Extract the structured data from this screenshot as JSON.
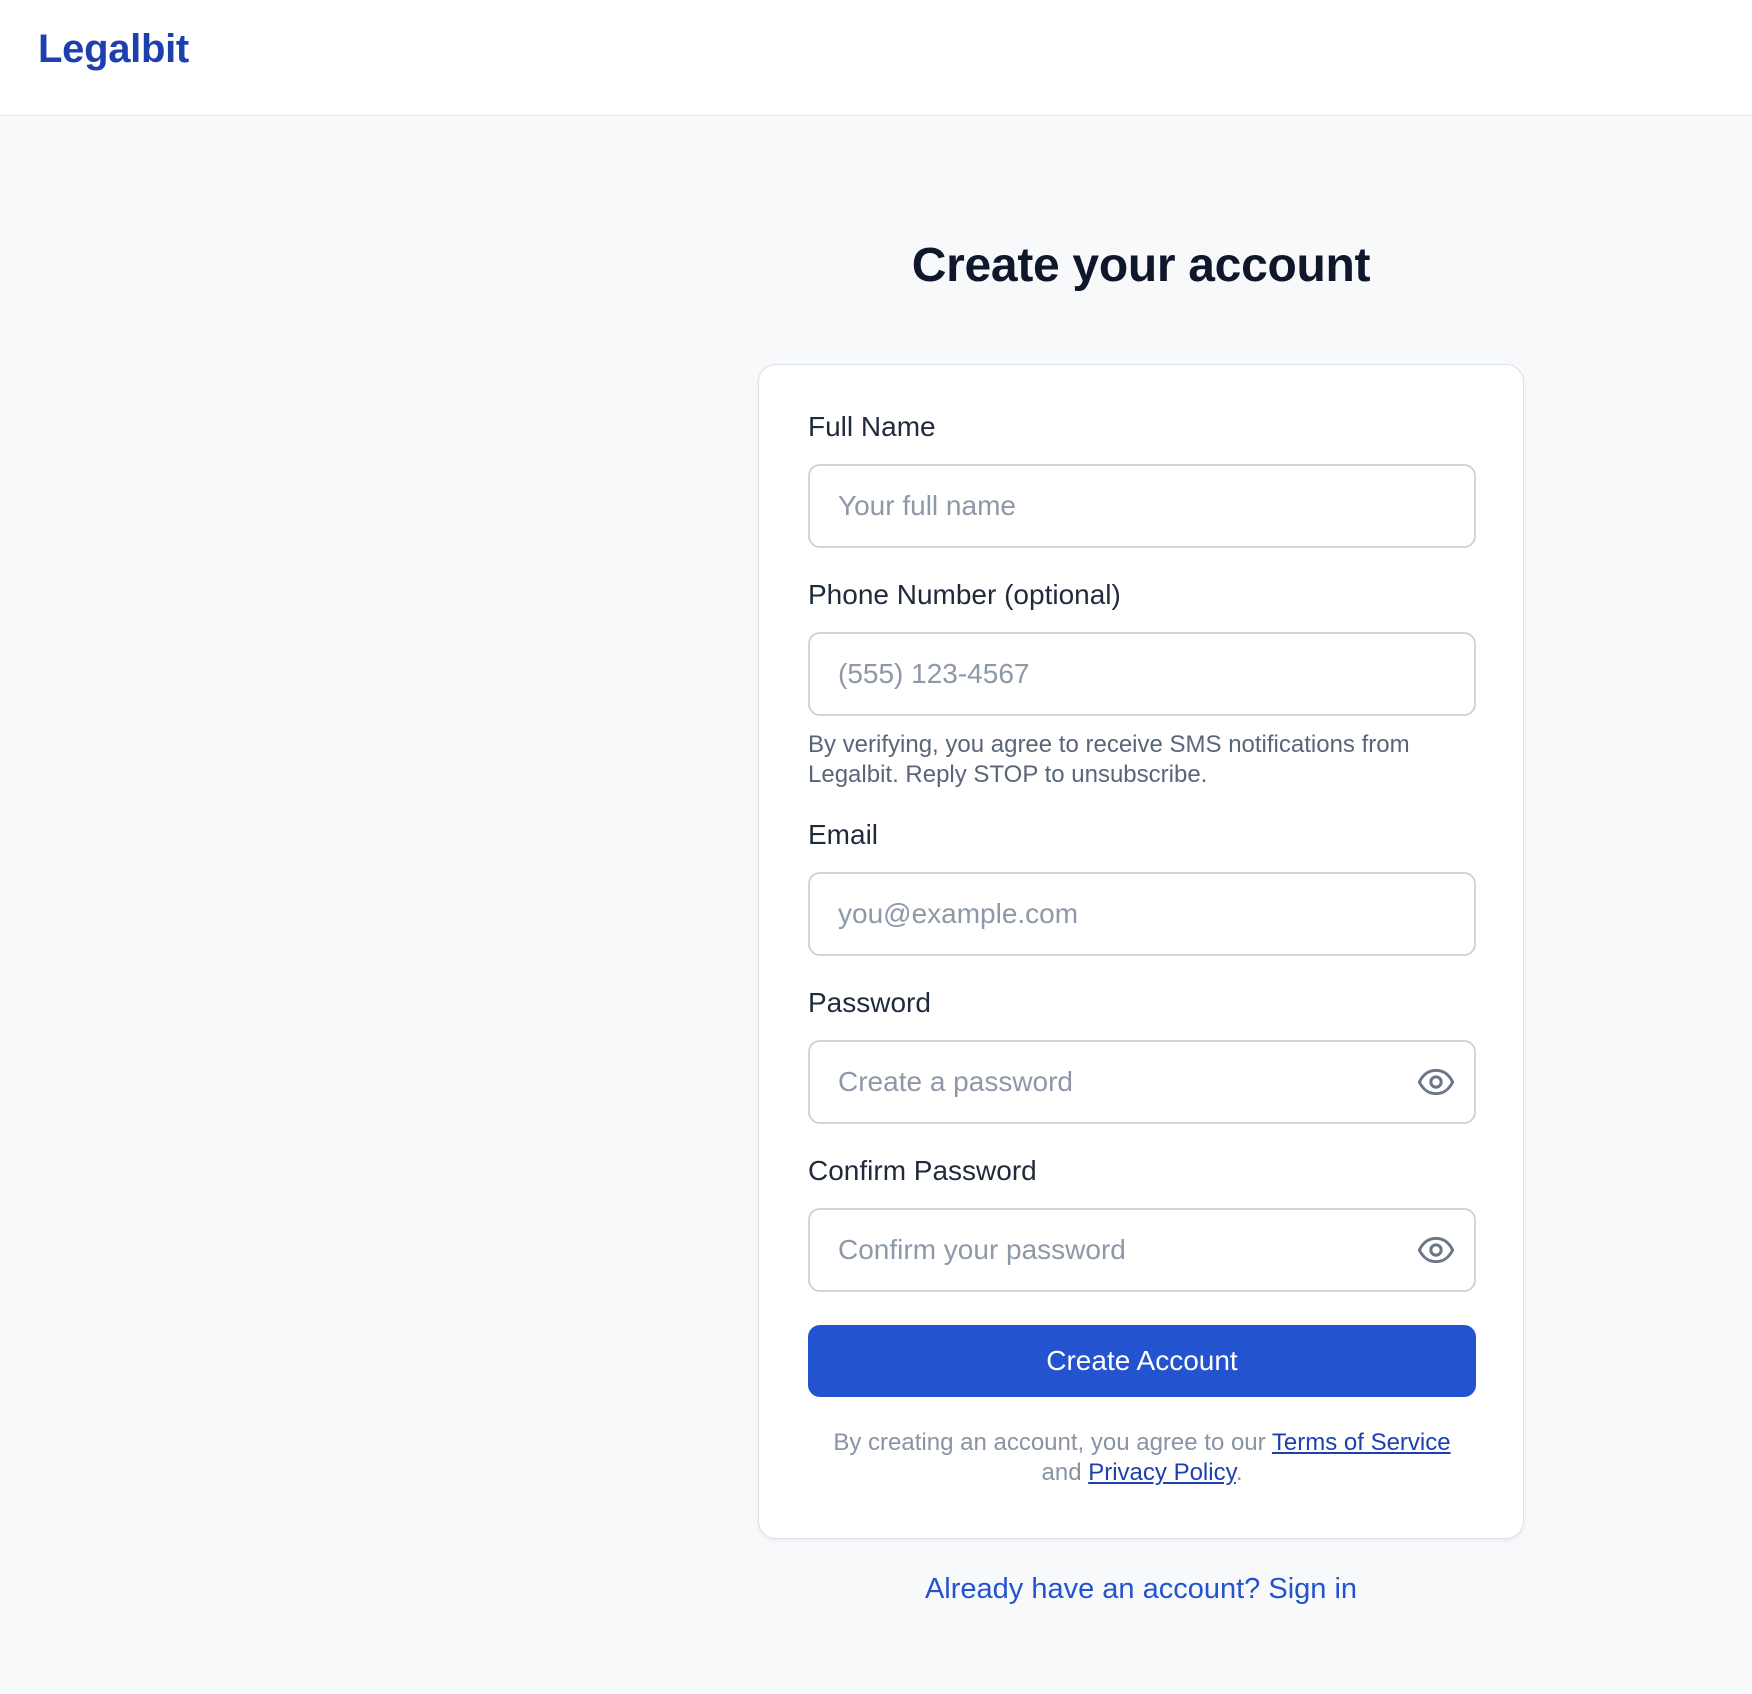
{
  "header": {
    "logo": "Legalbit"
  },
  "page": {
    "title": "Create your account"
  },
  "form": {
    "full_name": {
      "label": "Full Name",
      "placeholder": "Your full name",
      "value": ""
    },
    "phone": {
      "label": "Phone Number (optional)",
      "placeholder": "(555) 123-4567",
      "value": "",
      "helper_line1": "By verifying, you agree to receive SMS notifications from",
      "helper_line2": "Legalbit. Reply STOP to unsubscribe."
    },
    "email": {
      "label": "Email",
      "placeholder": "you@example.com",
      "value": ""
    },
    "password": {
      "label": "Password",
      "placeholder": "Create a password",
      "value": "",
      "toggle_icon": "eye-icon"
    },
    "confirm_password": {
      "label": "Confirm Password",
      "placeholder": "Confirm your password",
      "value": "",
      "toggle_icon": "eye-icon"
    },
    "submit_label": "Create Account",
    "terms": {
      "prefix": "By creating an account, you agree to our",
      "terms_link": "Terms of Service",
      "middle": "and",
      "privacy_link": "Privacy Policy",
      "suffix": "."
    }
  },
  "footer": {
    "signin_link": "Already have an account? Sign in"
  },
  "colors": {
    "brand": "#1e40af",
    "primary_button": "#2453cf",
    "page_background": "#f8f9fb",
    "heading": "#0f172a",
    "placeholder": "#8d98a8"
  }
}
